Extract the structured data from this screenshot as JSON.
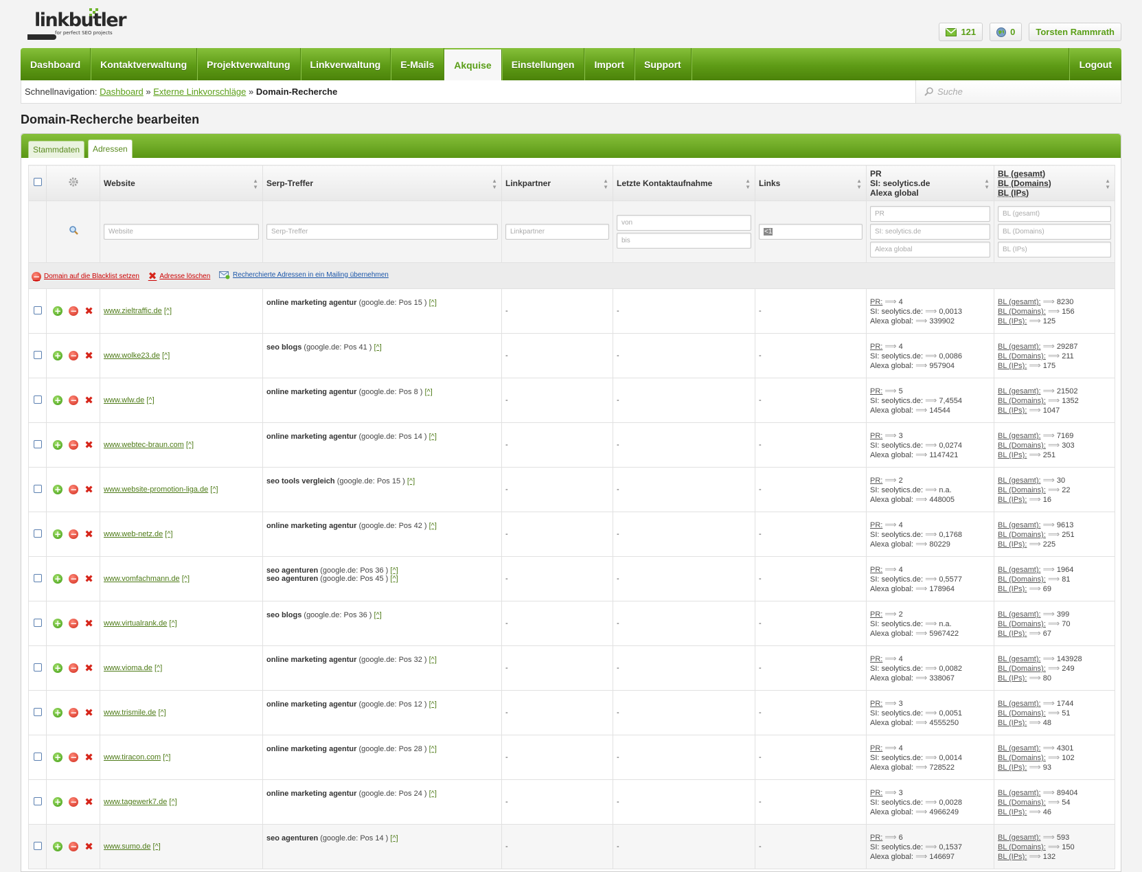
{
  "brand": {
    "name": "linkbutler",
    "tagline": "for perfect SEO projects"
  },
  "topbar": {
    "mail_count": "121",
    "globe_count": "0",
    "user": "Torsten Rammrath"
  },
  "nav": {
    "items": [
      "Dashboard",
      "Kontaktverwaltung",
      "Projektverwaltung",
      "Linkverwaltung",
      "E-Mails",
      "Akquise",
      "Einstellungen",
      "Import",
      "Support"
    ],
    "active": "Akquise",
    "logout": "Logout"
  },
  "breadcrumb": {
    "label": "Schnellnavigation:",
    "links": [
      "Dashboard",
      "Externe Linkvorschläge"
    ],
    "sep": "»",
    "current": "Domain-Recherche"
  },
  "search": {
    "placeholder": "Suche"
  },
  "page": {
    "title": "Domain-Recherche bearbeiten"
  },
  "tabs": [
    "Stammdaten",
    "Adressen"
  ],
  "active_tab": "Adressen",
  "table": {
    "columns": {
      "website": "Website",
      "serp": "Serp-Treffer",
      "linkpartner": "Linkpartner",
      "kontakt": "Letzte Kontaktaufnahme",
      "links": "Links",
      "pr": "PR",
      "si": "SI: seolytics.de",
      "alexa": "Alexa global",
      "bl1": "BL (gesamt)",
      "bl2": "BL (Domains)",
      "bl3": "BL (IPs)"
    },
    "filters": {
      "website": "Website",
      "serp": "Serp-Treffer",
      "linkpartner": "Linkpartner",
      "von": "von",
      "bis": "bis",
      "links": "<1",
      "pr": "PR",
      "si": "SI: seolytics.de",
      "alexa": "Alexa global",
      "bl1": "BL (gesamt)",
      "bl2": "BL (Domains)",
      "bl3": "BL (IPs)"
    },
    "actions": [
      "Domain auf die Blacklist setzen",
      "Adresse löschen",
      "Recherchierte Adressen in ein Mailing übernehmen"
    ],
    "labels": {
      "pr": "PR:",
      "si": "SI: seolytics.de:",
      "alexa": "Alexa global:",
      "bl1": "BL (gesamt):",
      "bl2": "BL (Domains):",
      "bl3": "BL (IPs):",
      "hat": "[^]",
      "dash": "-"
    },
    "rows": [
      {
        "site": "www.zieltraffic.de",
        "serp": [
          {
            "kw": "online marketing agentur",
            "info": "(google.de: Pos 15 )"
          }
        ],
        "pr": "4",
        "si": "0,0013",
        "alexa": "339902",
        "bl1": "8230",
        "bl2": "156",
        "bl3": "125"
      },
      {
        "site": "www.wolke23.de",
        "serp": [
          {
            "kw": "seo blogs",
            "info": "(google.de: Pos 41 )"
          }
        ],
        "pr": "4",
        "si": "0,0086",
        "alexa": "957904",
        "bl1": "29287",
        "bl2": "211",
        "bl3": "175"
      },
      {
        "site": "www.wlw.de",
        "serp": [
          {
            "kw": "online marketing agentur",
            "info": "(google.de: Pos 8 )"
          }
        ],
        "pr": "5",
        "si": "7,4554",
        "alexa": "14544",
        "bl1": "21502",
        "bl2": "1352",
        "bl3": "1047"
      },
      {
        "site": "www.webtec-braun.com",
        "serp": [
          {
            "kw": "online marketing agentur",
            "info": "(google.de: Pos 14 )"
          }
        ],
        "pr": "3",
        "si": "0,0274",
        "alexa": "1147421",
        "bl1": "7169",
        "bl2": "303",
        "bl3": "251"
      },
      {
        "site": "www.website-promotion-liga.de",
        "serp": [
          {
            "kw": "seo tools vergleich",
            "info": "(google.de: Pos 15 )"
          }
        ],
        "pr": "2",
        "si": "n.a.",
        "alexa": "448005",
        "bl1": "30",
        "bl2": "22",
        "bl3": "16"
      },
      {
        "site": "www.web-netz.de",
        "serp": [
          {
            "kw": "online marketing agentur",
            "info": "(google.de: Pos 42 )"
          }
        ],
        "pr": "4",
        "si": "0,1768",
        "alexa": "80229",
        "bl1": "9613",
        "bl2": "251",
        "bl3": "225"
      },
      {
        "site": "www.vomfachmann.de",
        "serp": [
          {
            "kw": "seo agenturen",
            "info": "(google.de: Pos 36 )"
          },
          {
            "kw": "seo agenturen",
            "info": "(google.de: Pos 45 )"
          }
        ],
        "pr": "4",
        "si": "0,5577",
        "alexa": "178964",
        "bl1": "1964",
        "bl2": "81",
        "bl3": "69"
      },
      {
        "site": "www.virtualrank.de",
        "serp": [
          {
            "kw": "seo blogs",
            "info": "(google.de: Pos 36 )"
          }
        ],
        "pr": "2",
        "si": "n.a.",
        "alexa": "5967422",
        "bl1": "399",
        "bl2": "70",
        "bl3": "67"
      },
      {
        "site": "www.vioma.de",
        "serp": [
          {
            "kw": "online marketing agentur",
            "info": "(google.de: Pos 32 )"
          }
        ],
        "pr": "4",
        "si": "0,0082",
        "alexa": "338067",
        "bl1": "143928",
        "bl2": "249",
        "bl3": "80"
      },
      {
        "site": "www.trismile.de",
        "serp": [
          {
            "kw": "online marketing agentur",
            "info": "(google.de: Pos 12 )"
          }
        ],
        "pr": "3",
        "si": "0,0051",
        "alexa": "4555250",
        "bl1": "1744",
        "bl2": "51",
        "bl3": "48"
      },
      {
        "site": "www.tiracon.com",
        "serp": [
          {
            "kw": "online marketing agentur",
            "info": "(google.de: Pos 28 )"
          }
        ],
        "pr": "4",
        "si": "0,0014",
        "alexa": "728522",
        "bl1": "4301",
        "bl2": "102",
        "bl3": "93"
      },
      {
        "site": "www.tagewerk7.de",
        "serp": [
          {
            "kw": "online marketing agentur",
            "info": "(google.de: Pos 24 )"
          }
        ],
        "pr": "3",
        "si": "0,0028",
        "alexa": "4966249",
        "bl1": "89404",
        "bl2": "54",
        "bl3": "46"
      },
      {
        "site": "www.sumo.de",
        "serp": [
          {
            "kw": "seo agenturen",
            "info": "(google.de: Pos 14 )"
          }
        ],
        "pr": "6",
        "si": "0,1537",
        "alexa": "146697",
        "bl1": "593",
        "bl2": "150",
        "bl3": "132"
      }
    ]
  },
  "colors": {
    "brand_green": "#5a9e17",
    "nav_green": "#6aa81f",
    "danger": "#d0281a",
    "link_blue": "#1a55a8"
  }
}
